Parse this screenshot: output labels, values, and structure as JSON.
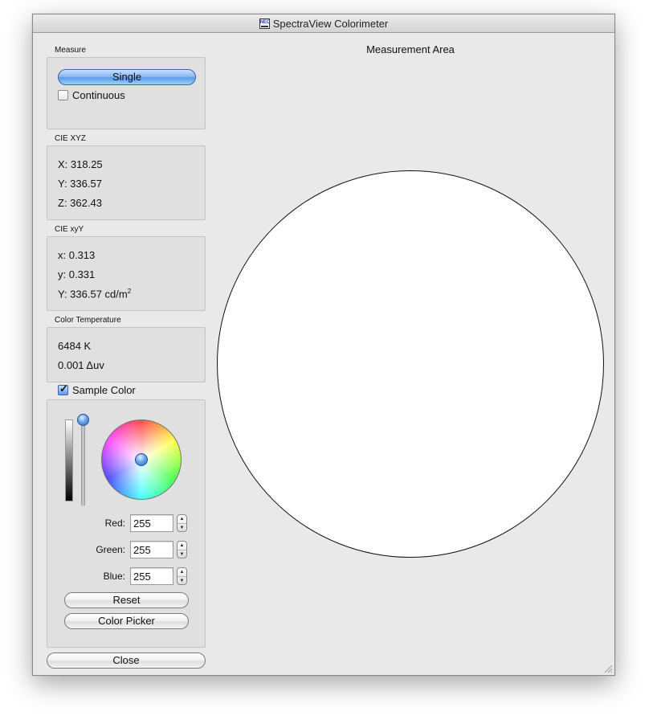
{
  "window": {
    "title": "SpectraView Colorimeter",
    "app_icon_text": "NEC"
  },
  "measure": {
    "label": "Measure",
    "single_label": "Single",
    "continuous_label": "Continuous",
    "continuous_checked": false
  },
  "cie_xyz": {
    "label": "CIE XYZ",
    "x": "X: 318.25",
    "y": "Y: 336.57",
    "z": "Z: 362.43"
  },
  "cie_xyy": {
    "label": "CIE xyY",
    "x": "x: 0.313",
    "y": "y: 0.331",
    "Y_prefix": "Y: 336.57 cd/m",
    "Y_sup": "2"
  },
  "color_temperature": {
    "label": "Color Temperature",
    "cct": "6484 K",
    "duv": "0.001 Δuv"
  },
  "sample_color": {
    "label": "Sample Color",
    "checked": true,
    "brightness": 1.0,
    "red_label": "Red:",
    "red_value": "255",
    "green_label": "Green:",
    "green_value": "255",
    "blue_label": "Blue:",
    "blue_value": "255",
    "reset_label": "Reset",
    "color_picker_label": "Color Picker"
  },
  "close_label": "Close",
  "measurement_area": {
    "title": "Measurement Area",
    "sample_fill": "#ffffff"
  },
  "colors": {
    "window_bg": "#e9e9e9",
    "group_bg": "#e0e0e0",
    "accent_blue": "#5d9be8"
  },
  "icons": {
    "stepper_up": "▲",
    "stepper_down": "▼",
    "check": "✓"
  }
}
